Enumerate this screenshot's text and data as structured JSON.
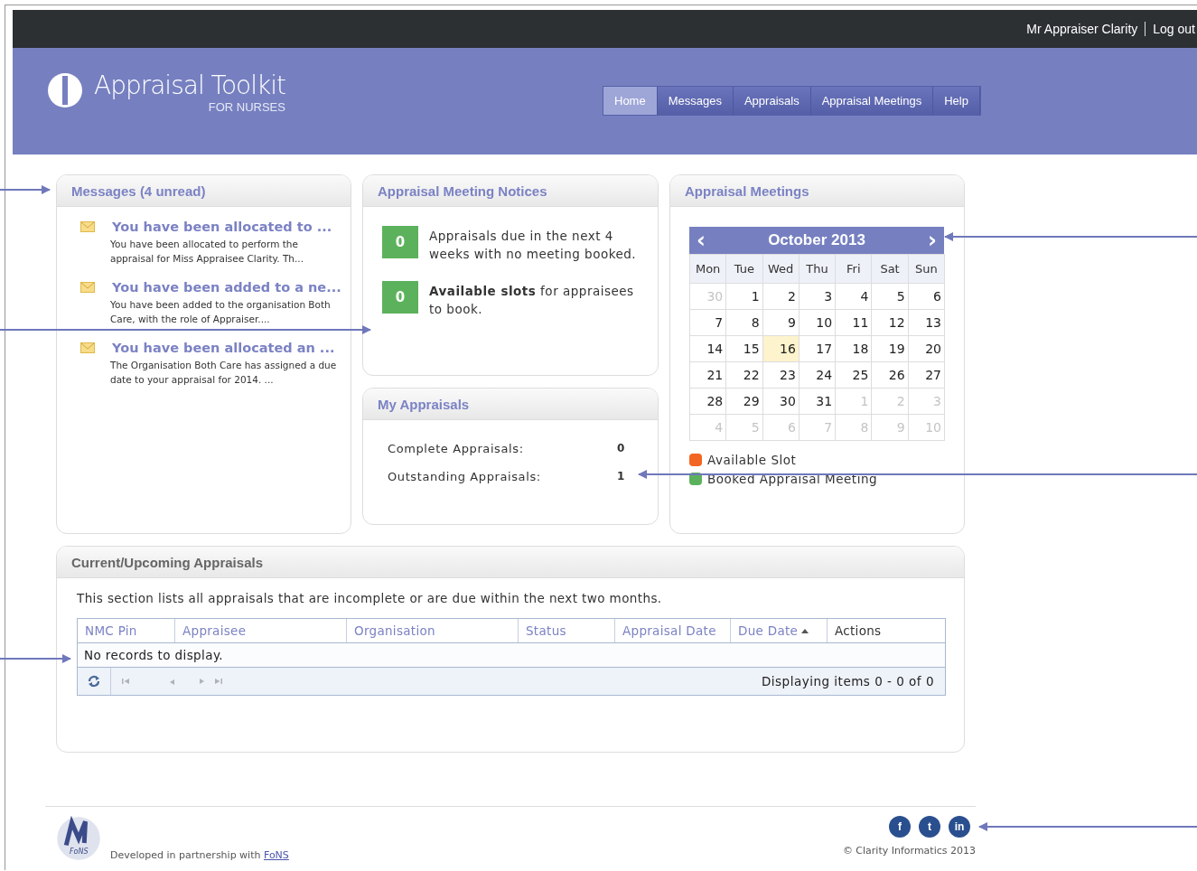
{
  "top_bar": {
    "user": "Mr Appraiser Clarity",
    "logout": "Log out"
  },
  "brand": {
    "title": "Appraisal Toolkit",
    "subtitle": "FOR NURSES"
  },
  "nav": [
    {
      "label": "Home",
      "selected": true
    },
    {
      "label": "Messages",
      "selected": false
    },
    {
      "label": "Appraisals",
      "selected": false
    },
    {
      "label": "Appraisal Meetings",
      "selected": false
    },
    {
      "label": "Help",
      "selected": false
    }
  ],
  "messages": {
    "title": "Messages (4 unread)",
    "items": [
      {
        "subject": "You have been allocated to ...",
        "preview": "You have been allocated to perform the appraisal for Miss Appraisee Clarity. Th...",
        "unread": true
      },
      {
        "subject": "You have been added to a ne...",
        "preview": "You have been added to the organisation Both Care, with the role of Appraiser....",
        "unread": true
      },
      {
        "subject": "You have been allocated an ...",
        "preview": "The Organisation Both Care has assigned a due date to your appraisal for 2014. ...",
        "unread": true
      }
    ]
  },
  "notices": {
    "title": "Appraisal Meeting Notices",
    "items": [
      {
        "count": "0",
        "text": "Appraisals due in the next 4 weeks with no meeting booked."
      },
      {
        "count": "0",
        "text": "**Available slots** for appraisees to book."
      }
    ]
  },
  "my_appraisals": {
    "title": "My Appraisals",
    "rows": [
      {
        "label": "Complete Appraisals:",
        "value": "0"
      },
      {
        "label": "Outstanding Appraisals:",
        "value": "1"
      }
    ]
  },
  "meetings": {
    "title": "Appraisal Meetings",
    "calendar": {
      "month": "October 2013",
      "prev": "‹",
      "next": "›",
      "weekdays": [
        "Mon",
        "Tue",
        "Wed",
        "Thu",
        "Fri",
        "Sat",
        "Sun"
      ],
      "weeks": [
        [
          {
            "day": "30",
            "other": true,
            "selected": false
          },
          {
            "day": "1",
            "other": false,
            "selected": false
          },
          {
            "day": "2",
            "other": false,
            "selected": false
          },
          {
            "day": "3",
            "other": false,
            "selected": false
          },
          {
            "day": "4",
            "other": false,
            "selected": false
          },
          {
            "day": "5",
            "other": false,
            "selected": false
          },
          {
            "day": "6",
            "other": false,
            "selected": false
          }
        ],
        [
          {
            "day": "7",
            "other": false,
            "selected": false
          },
          {
            "day": "8",
            "other": false,
            "selected": false
          },
          {
            "day": "9",
            "other": false,
            "selected": false
          },
          {
            "day": "10",
            "other": false,
            "selected": false
          },
          {
            "day": "11",
            "other": false,
            "selected": false
          },
          {
            "day": "12",
            "other": false,
            "selected": false
          },
          {
            "day": "13",
            "other": false,
            "selected": false
          }
        ],
        [
          {
            "day": "14",
            "other": false,
            "selected": false
          },
          {
            "day": "15",
            "other": false,
            "selected": false
          },
          {
            "day": "16",
            "other": false,
            "selected": true
          },
          {
            "day": "17",
            "other": false,
            "selected": false
          },
          {
            "day": "18",
            "other": false,
            "selected": false
          },
          {
            "day": "19",
            "other": false,
            "selected": false
          },
          {
            "day": "20",
            "other": false,
            "selected": false
          }
        ],
        [
          {
            "day": "21",
            "other": false,
            "selected": false
          },
          {
            "day": "22",
            "other": false,
            "selected": false
          },
          {
            "day": "23",
            "other": false,
            "selected": false
          },
          {
            "day": "24",
            "other": false,
            "selected": false
          },
          {
            "day": "25",
            "other": false,
            "selected": false
          },
          {
            "day": "26",
            "other": false,
            "selected": false
          },
          {
            "day": "27",
            "other": false,
            "selected": false
          }
        ],
        [
          {
            "day": "28",
            "other": false,
            "selected": false
          },
          {
            "day": "29",
            "other": false,
            "selected": false
          },
          {
            "day": "30",
            "other": false,
            "selected": false
          },
          {
            "day": "31",
            "other": false,
            "selected": false
          },
          {
            "day": "1",
            "other": true,
            "selected": false
          },
          {
            "day": "2",
            "other": true,
            "selected": false
          },
          {
            "day": "3",
            "other": true,
            "selected": false
          }
        ],
        [
          {
            "day": "4",
            "other": true,
            "selected": false
          },
          {
            "day": "5",
            "other": true,
            "selected": false
          },
          {
            "day": "6",
            "other": true,
            "selected": false
          },
          {
            "day": "7",
            "other": true,
            "selected": false
          },
          {
            "day": "8",
            "other": true,
            "selected": false
          },
          {
            "day": "9",
            "other": true,
            "selected": false
          },
          {
            "day": "10",
            "other": true,
            "selected": false
          }
        ]
      ]
    },
    "legend": [
      {
        "label": "Available Slot",
        "color": "#f26522"
      },
      {
        "label": "Booked Appraisal Meeting",
        "color": "#5cb25c"
      }
    ]
  },
  "upcoming": {
    "title": "Current/Upcoming Appraisals",
    "intro": "This section lists all appraisals that are incomplete or are due within the next two months.",
    "columns": [
      {
        "label": "NMC Pin",
        "link": true,
        "sorted": false
      },
      {
        "label": "Appraisee",
        "link": true,
        "sorted": false
      },
      {
        "label": "Organisation",
        "link": true,
        "sorted": false
      },
      {
        "label": "Status",
        "link": true,
        "sorted": false
      },
      {
        "label": "Appraisal Date",
        "link": true,
        "sorted": false
      },
      {
        "label": "Due Date",
        "link": true,
        "sorted": true
      },
      {
        "label": "Actions",
        "link": false,
        "sorted": false
      }
    ],
    "empty": "No records to display.",
    "pager": {
      "info": "Displaying items 0 - 0 of 0",
      "disabled": true
    }
  },
  "footer": {
    "logo": "FoNS",
    "credit": "Developed in partnership with",
    "credit_link": "FoNS",
    "social": [
      "f",
      "t",
      "in"
    ],
    "copyright": "© Clarity Informatics 2013"
  }
}
